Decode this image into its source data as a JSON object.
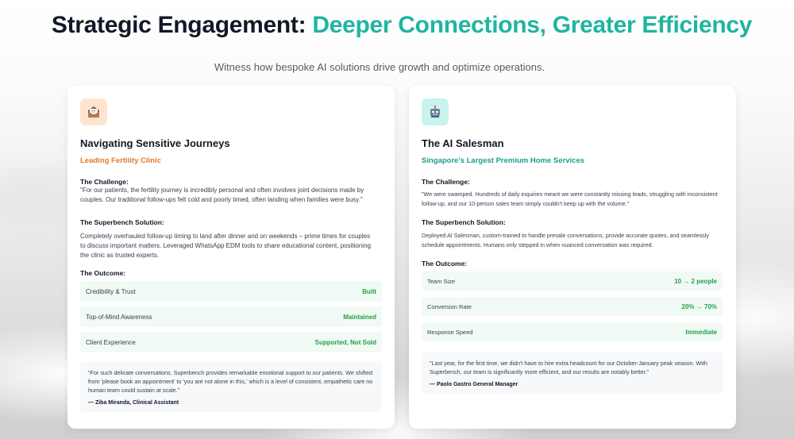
{
  "header": {
    "title_main": "Strategic Engagement:",
    "title_accent": "Deeper Connections, Greater Efficiency",
    "subtitle": "Witness how bespoke AI solutions drive growth and optimize operations."
  },
  "cards": [
    {
      "icon": "envelope-icon",
      "title": "Navigating Sensitive Journeys",
      "subtitle": "Leading Fertility Clinic",
      "challenge_heading": "The Challenge:",
      "challenge_text": "\"For our patients, the fertility journey is incredibly personal and often involves joint decisions made by couples. Our traditional follow-ups felt cold and poorly timed, often landing when families were busy.\"",
      "solution_heading": "The Superbench Solution:",
      "solution_text": "Completely overhauled follow-up timing to land after dinner and on weekends – prime times for couples to discuss important matters. Leveraged WhatsApp EDM tools to share educational content, positioning the clinic as trusted experts.",
      "outcome_heading": "The Outcome:",
      "outcomes": [
        {
          "label": "Credibility & Trust",
          "value": "Built"
        },
        {
          "label": "Top-of-Mind Awareness",
          "value": "Maintained"
        },
        {
          "label": "Client Experience",
          "value": "Supported, Not Sold"
        }
      ],
      "quote": "\"For such delicate conversations, Superbench provides remarkable emotional support to our patients. We shifted from 'please book an appointment' to 'you are not alone in this,' which is a level of consistent, empathetic care no human team could sustain at scale.\"",
      "quote_author": "— Ziba Miranda, Clinical Assistant"
    },
    {
      "icon": "robot-icon",
      "title": "The AI Salesman",
      "subtitle": "Singapore's Largest Premium Home Services",
      "challenge_heading": "The Challenge:",
      "challenge_text": "\"We were swamped. Hundreds of daily inquiries meant we were constantly missing leads, struggling with inconsistent follow-up, and our 10-person sales team simply couldn't keep up with the volume.\"",
      "solution_heading": "The Superbench Solution:",
      "solution_text": "Deployed AI Salesman, custom-trained to handle presale conversations, provide accurate quotes, and seamlessly schedule appointments. Humans only stepped in when nuanced conversation was required.",
      "outcome_heading": "The Outcome:",
      "outcomes": [
        {
          "label": "Team Size",
          "value": "10 → 2 people"
        },
        {
          "label": "Conversion Rate",
          "value": "20% → 70%"
        },
        {
          "label": "Response Speed",
          "value": "Immediate"
        }
      ],
      "quote": "\"Last year, for the first time, we didn't have to hire extra headcount for our October-January peak season. With Superbench, our team is significantly more efficient, and our results are notably better.\"",
      "quote_author": "— Paolo Gastro General Manager"
    }
  ],
  "colors": {
    "accent_teal": "#1fb5a0",
    "subtitle_orange": "#e07a2e",
    "subtitle_teal": "#1a9e8c",
    "outcome_green": "#22a04a"
  }
}
